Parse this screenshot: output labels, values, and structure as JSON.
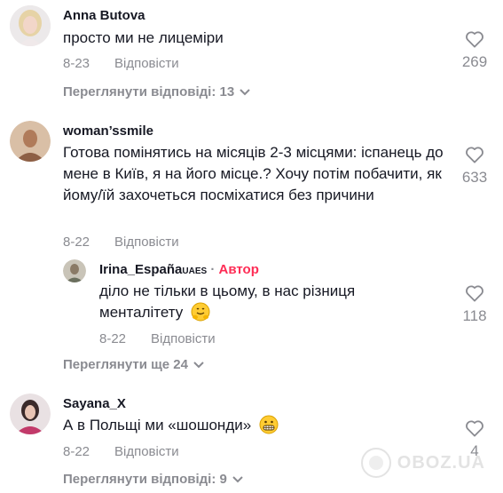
{
  "comments": [
    {
      "username": "Anna Butova",
      "text": "просто ми не лицеміри",
      "date": "8-23",
      "reply_label": "Відповісти",
      "likes": "269",
      "view_replies": "Переглянути відповіді: 13"
    },
    {
      "username": "woman’ssmile",
      "text": "Готова помінятись на місяців 2-3 місцями: іспанець до мене в Київ, я на його місце.? Хочу потім побачити, як йому/їй захочеться посміхатися без причини",
      "date": "8-22",
      "reply_label": "Відповісти",
      "likes": "633",
      "reply": {
        "username": "Irina_España",
        "flag_suffix": "UAES",
        "separator": "·",
        "author_label": "Автор",
        "text": "діло не тільки в цьому, в нас різниця менталітету",
        "date": "8-22",
        "reply_label": "Відповісти",
        "likes": "118"
      },
      "view_more": "Переглянути ще 24"
    },
    {
      "username": "Sayana_X",
      "text": "А в Польщі ми «шошонди»",
      "date": "8-22",
      "reply_label": "Відповісти",
      "likes": "4",
      "view_replies": "Переглянути відповіді: 9"
    }
  ],
  "watermark": "OBOZ.UA"
}
